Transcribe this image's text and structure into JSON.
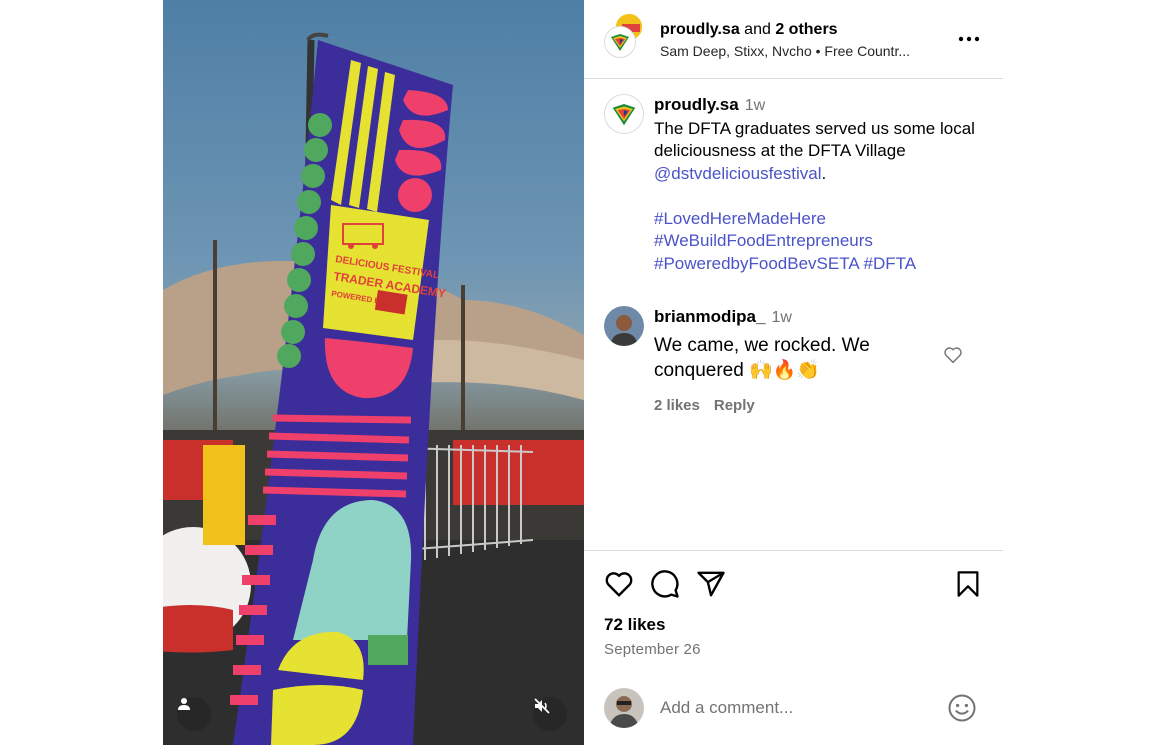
{
  "header": {
    "username": "proudly.sa",
    "joiner": "and",
    "others": "2 others",
    "collaborators": "Sam Deep, Stixx, Nvcho • Free Countr..."
  },
  "caption": {
    "username": "proudly.sa",
    "time": "1w",
    "text": "The DFTA graduates served us some local deliciousness at the DFTA Village ",
    "mention": "@dstvdeliciousfestival",
    "period": ".",
    "hashtags": [
      "#LovedHereMadeHere",
      "#WeBuildFoodEntrepreneurs",
      "#PoweredbyFoodBevSETA",
      "#DFTA"
    ]
  },
  "comment": {
    "username": "brianmodipa_",
    "time": "1w",
    "text": "We came, we rocked. We conquered 🙌🔥👏",
    "likes": "2 likes",
    "reply": "Reply"
  },
  "post": {
    "likes": "72 likes",
    "date": "September 26"
  },
  "add_comment": {
    "placeholder": "Add a comment..."
  },
  "banner": {
    "line1": "DELICIOUS FESTIVAL",
    "line2": "TRADER ACADEMY",
    "line3": "POWERED BY"
  },
  "colors": {
    "link": "#4a53c8",
    "banner_navy": "#3b2e9a",
    "banner_pink": "#ef3f6b",
    "banner_yellow": "#e6e231",
    "banner_green": "#4fa85e",
    "banner_teal": "#8fd3c6"
  }
}
